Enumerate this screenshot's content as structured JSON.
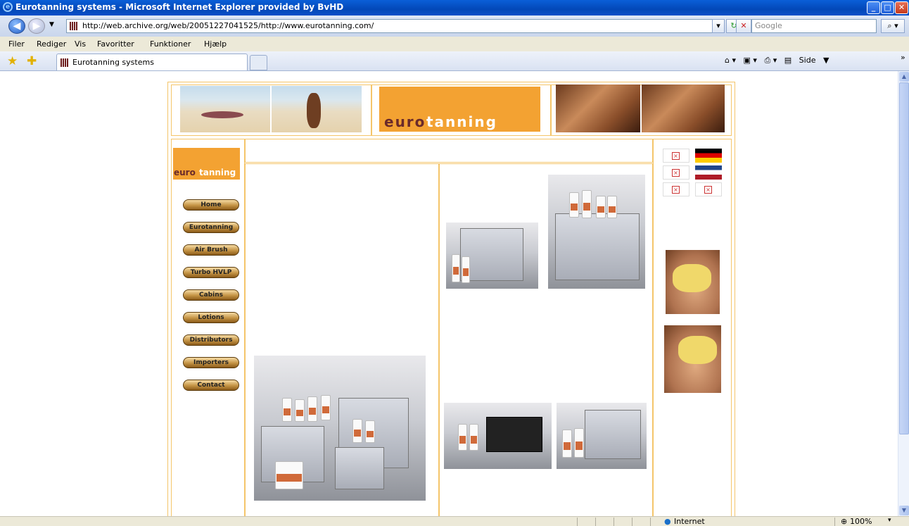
{
  "window": {
    "title": "Eurotanning systems - Microsoft Internet Explorer provided by BvHD",
    "minimize": "_",
    "maximize": "□",
    "close": "✕"
  },
  "address": {
    "url": "http://web.archive.org/web/20051227041525/http://www.eurotanning.com/",
    "search_placeholder": "Google"
  },
  "menu": {
    "items": [
      "Filer",
      "Rediger",
      "Vis",
      "Favoritter",
      "Funktioner",
      "Hjælp"
    ]
  },
  "tabs": {
    "active": "Eurotanning systems"
  },
  "commandbar": {
    "page_label": "Side",
    "more": "»"
  },
  "page": {
    "logo_text_a": "euro",
    "logo_text_b": "tanning",
    "nav": [
      "Home",
      "Eurotanning",
      "Air Brush",
      "Turbo HVLP",
      "Cabins",
      "Lotions",
      "Distributors",
      "Importers",
      "Contact"
    ],
    "broken_image_glyph": "×"
  },
  "status": {
    "zone": "Internet",
    "zoom": "100%"
  },
  "colors": {
    "accent": "#f3a232",
    "frame": "#f4c56a",
    "titlebar": "#0348b8"
  }
}
